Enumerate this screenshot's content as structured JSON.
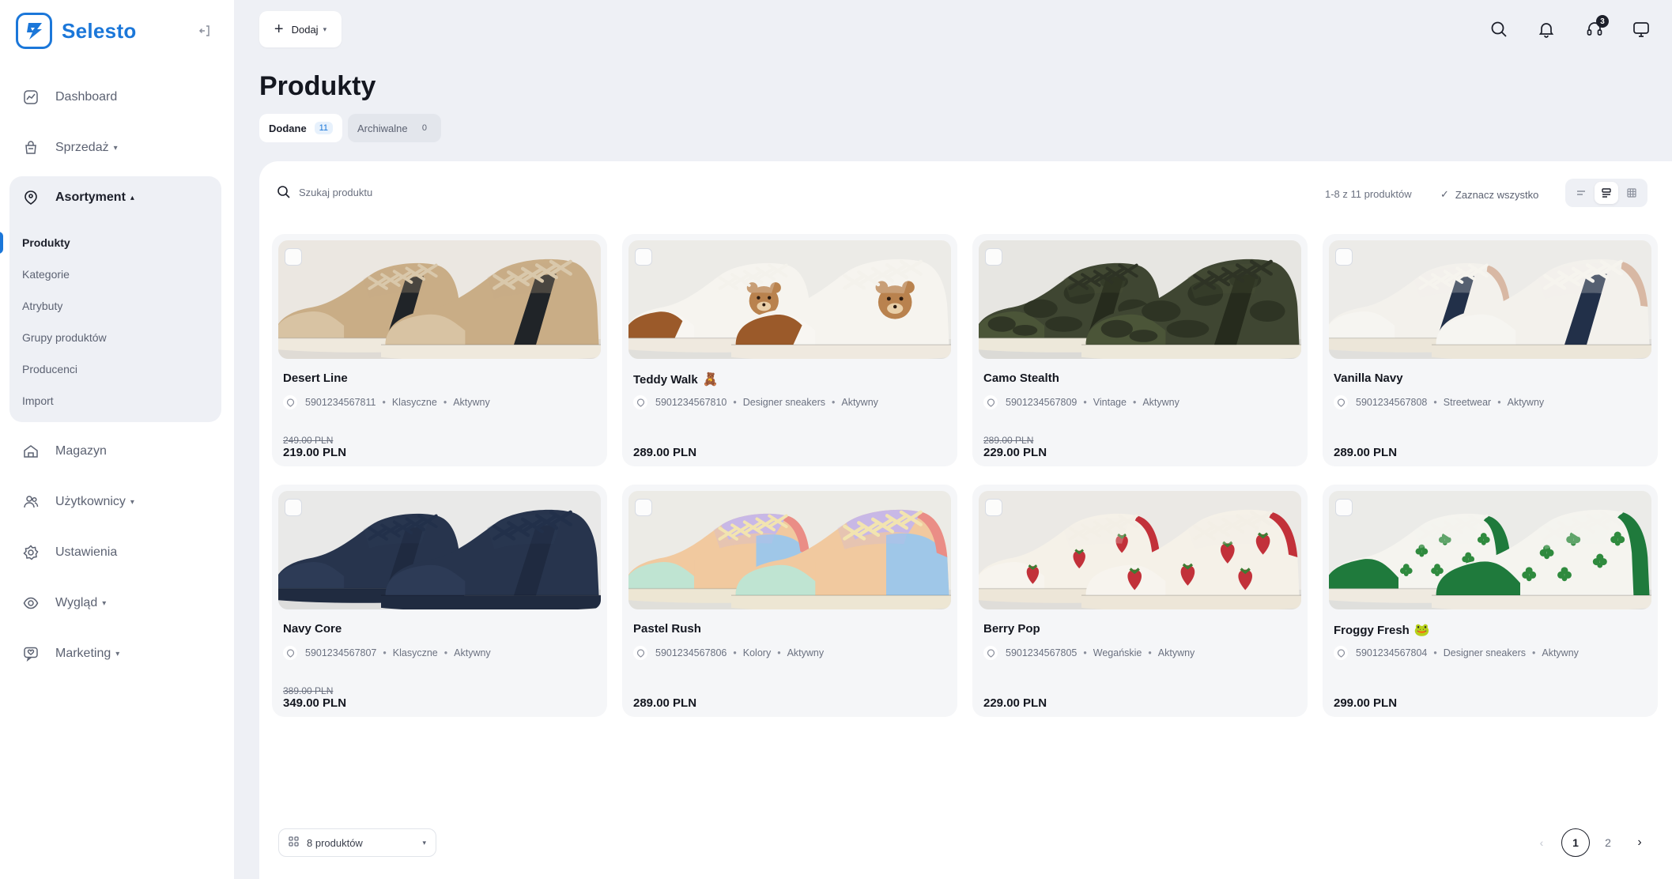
{
  "brand": {
    "name": "Selesto"
  },
  "sidebar": {
    "items": [
      {
        "label": "Dashboard",
        "icon": "chart-icon",
        "has_caret": false
      },
      {
        "label": "Sprzedaż",
        "icon": "cart-icon",
        "has_caret": true
      },
      {
        "label": "Magazyn",
        "icon": "warehouse-icon",
        "has_caret": false
      },
      {
        "label": "Użytkownicy",
        "icon": "users-icon",
        "has_caret": true
      },
      {
        "label": "Ustawienia",
        "icon": "gear-icon",
        "has_caret": false
      },
      {
        "label": "Wygląd",
        "icon": "eye-icon",
        "has_caret": true
      },
      {
        "label": "Marketing",
        "icon": "megaphone-icon",
        "has_caret": true
      }
    ],
    "group": {
      "label": "Asortyment",
      "sub_items": [
        "Produkty",
        "Kategorie",
        "Atrybuty",
        "Grupy produktów",
        "Producenci",
        "Import"
      ],
      "active": "Produkty"
    }
  },
  "toolbar": {
    "add_label": "Dodaj",
    "notifications_badge": "3"
  },
  "page": {
    "title": "Produkty",
    "tabs": [
      {
        "label": "Dodane",
        "count": "11"
      },
      {
        "label": "Archiwalne",
        "count": "0"
      }
    ]
  },
  "list": {
    "search_placeholder": "Szukaj produktu",
    "range_text": "1-8 z 11 produktów",
    "select_all_label": "Zaznacz wszystko",
    "per_page_label": "8 produktów",
    "pages": [
      "1",
      "2"
    ],
    "current_page": "1"
  },
  "products": [
    {
      "name": "Desert Line",
      "emoji": "",
      "code": "5901234567811",
      "category": "Klasyczne",
      "status": "Aktywny",
      "old_price": "249.00 PLN",
      "price": "219.00 PLN",
      "design": "desert"
    },
    {
      "name": "Teddy Walk",
      "emoji": "🧸",
      "code": "5901234567810",
      "category": "Designer sneakers",
      "status": "Aktywny",
      "old_price": "",
      "price": "289.00 PLN",
      "design": "teddy"
    },
    {
      "name": "Camo Stealth",
      "emoji": "",
      "code": "5901234567809",
      "category": "Vintage",
      "status": "Aktywny",
      "old_price": "289.00 PLN",
      "price": "229.00 PLN",
      "design": "camo"
    },
    {
      "name": "Vanilla Navy",
      "emoji": "",
      "code": "5901234567808",
      "category": "Streetwear",
      "status": "Aktywny",
      "old_price": "",
      "price": "289.00 PLN",
      "design": "vanilla"
    },
    {
      "name": "Navy Core",
      "emoji": "",
      "code": "5901234567807",
      "category": "Klasyczne",
      "status": "Aktywny",
      "old_price": "389.00 PLN",
      "price": "349.00 PLN",
      "design": "navy"
    },
    {
      "name": "Pastel Rush",
      "emoji": "",
      "code": "5901234567806",
      "category": "Kolory",
      "status": "Aktywny",
      "old_price": "",
      "price": "289.00 PLN",
      "design": "pastel"
    },
    {
      "name": "Berry Pop",
      "emoji": "",
      "code": "5901234567805",
      "category": "Wegańskie",
      "status": "Aktywny",
      "old_price": "",
      "price": "229.00 PLN",
      "design": "berry"
    },
    {
      "name": "Froggy Fresh",
      "emoji": "🐸",
      "code": "5901234567804",
      "category": "Designer sneakers",
      "status": "Aktywny",
      "old_price": "",
      "price": "299.00 PLN",
      "design": "froggy"
    }
  ],
  "colors": {
    "accent": "#1b77d9",
    "background": "#eef0f5",
    "card": "#f5f6f8",
    "text": "#141720",
    "muted": "#6b7180"
  }
}
